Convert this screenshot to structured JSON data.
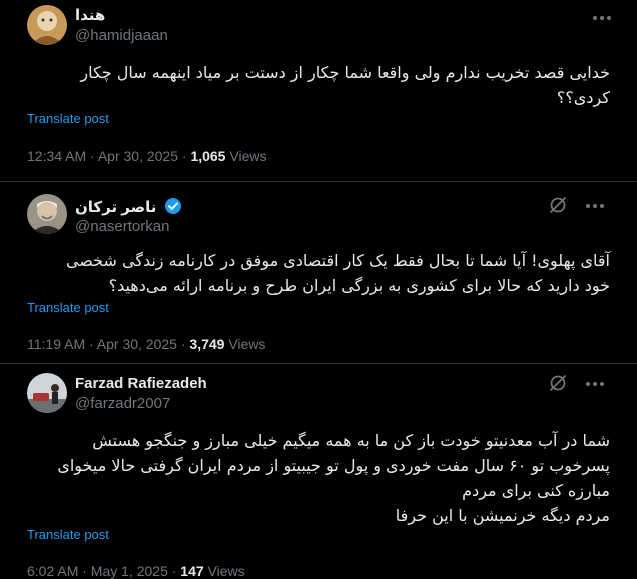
{
  "posts": [
    {
      "name": "هندا",
      "handle": "@hamidjaaan",
      "text_lines": [
        "خدایی قصد تخریب ندارم ولی واقعا شما چکار از دستت بر میاد اینهمه سال چکار",
        "کردی؟؟"
      ],
      "translate": "Translate post",
      "time": "12:34 AM · Apr 30, 2025 · ",
      "views_count": "1,065",
      "views_label": "Views"
    },
    {
      "name": "ناصر ترکان",
      "handle": "@nasertorkan",
      "verified": true,
      "text_lines": [
        "آقای پهلوی! آیا شما تا بحال فقط یک کار اقتصادی موفق در کارنامه زندگی شخصی",
        "خود دارید که حالا برای کشوری به بزرگی ایران طرح و برنامه ارائه می‌دهید؟"
      ],
      "translate": "Translate post",
      "time": "11:19 AM · Apr 30, 2025 · ",
      "views_count": "3,749",
      "views_label": "Views"
    },
    {
      "name": "Farzad Rafiezadeh",
      "handle": "@farzadr2007",
      "text_lines": [
        "شما در آب معدنیتو خودت باز کن ما به همه میگیم خیلی مبارز و جنگجو هستش",
        "پسرخوب تو ۶۰ سال مفت خوردی و پول تو جیبیتو از مردم ایران گرفتی حالا میخوای",
        "مبارزه کنی برای مردم",
        "مردم دیگه خرنمیشن با این حرفا"
      ],
      "translate": "Translate post",
      "time": "6:02 AM · May 1, 2025 · ",
      "views_count": "147",
      "views_label": "Views"
    }
  ],
  "colors": {
    "background": "#000000",
    "text": "#e7e9ea",
    "secondary": "#71767b",
    "link": "#1d9bf0",
    "separator": "#2f3336"
  },
  "icons": [
    "more-icon",
    "grok-icon",
    "verified-badge-icon"
  ]
}
